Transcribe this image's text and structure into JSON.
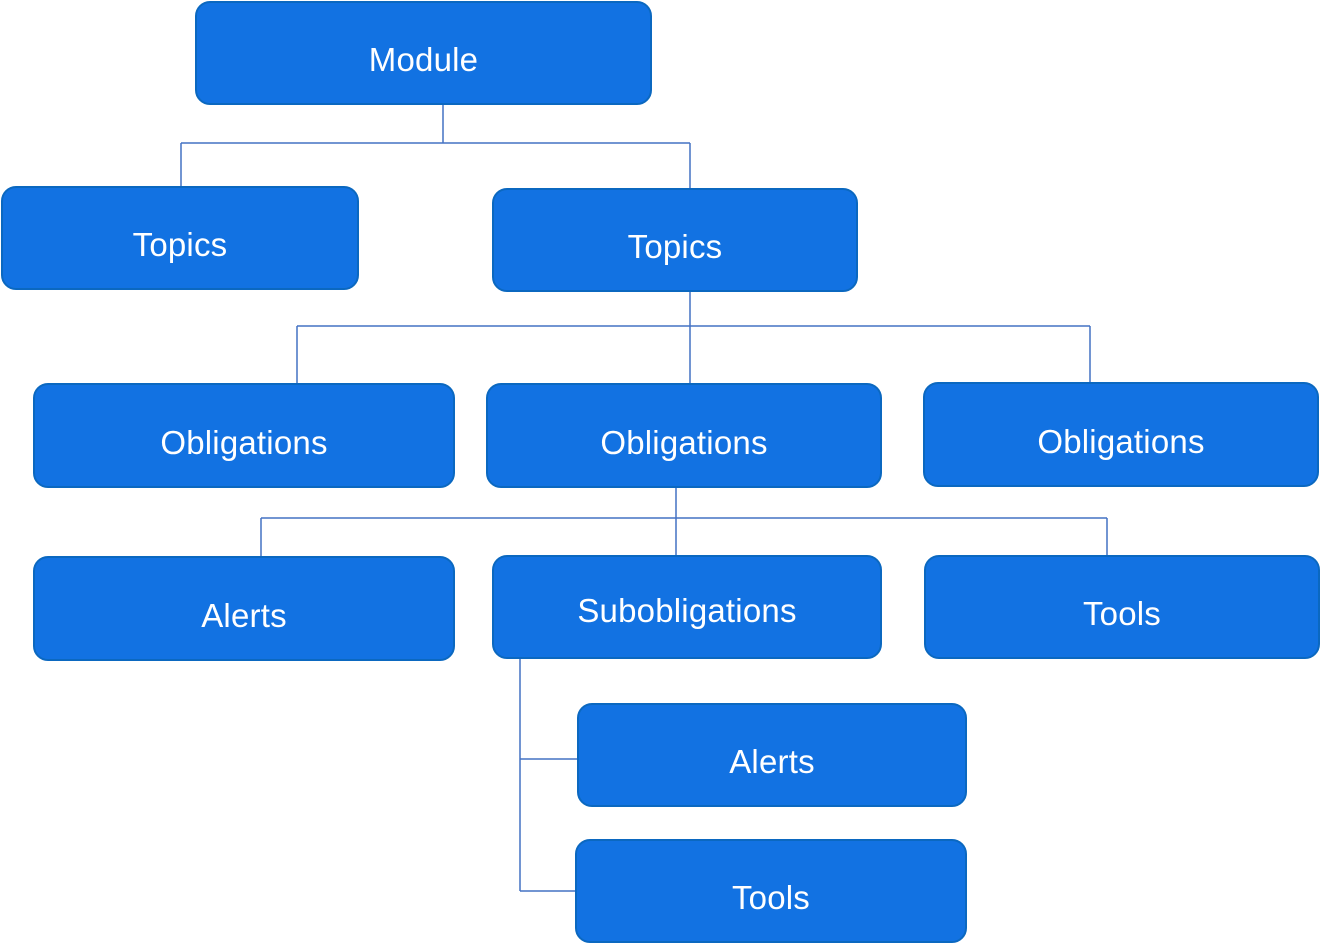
{
  "diagram": {
    "type": "hierarchy",
    "colors": {
      "node_fill": "#1272e2",
      "node_border": "#0b68c0",
      "node_text": "#ffffff",
      "connector": "#4472c4"
    },
    "nodes": {
      "module": "Module",
      "topics_1": "Topics",
      "topics_2": "Topics",
      "obligations_1": "Obligations",
      "obligations_2": "Obligations",
      "obligations_3": "Obligations",
      "alerts_1": "Alerts",
      "subobligations": "Subobligations",
      "tools_1": "Tools",
      "alerts_2": "Alerts",
      "tools_2": "Tools"
    },
    "edges": [
      [
        "module",
        "topics_1"
      ],
      [
        "module",
        "topics_2"
      ],
      [
        "topics_2",
        "obligations_1"
      ],
      [
        "topics_2",
        "obligations_2"
      ],
      [
        "topics_2",
        "obligations_3"
      ],
      [
        "obligations_2",
        "alerts_1"
      ],
      [
        "obligations_2",
        "subobligations"
      ],
      [
        "obligations_2",
        "tools_1"
      ],
      [
        "subobligations",
        "alerts_2"
      ],
      [
        "subobligations",
        "tools_2"
      ]
    ]
  }
}
